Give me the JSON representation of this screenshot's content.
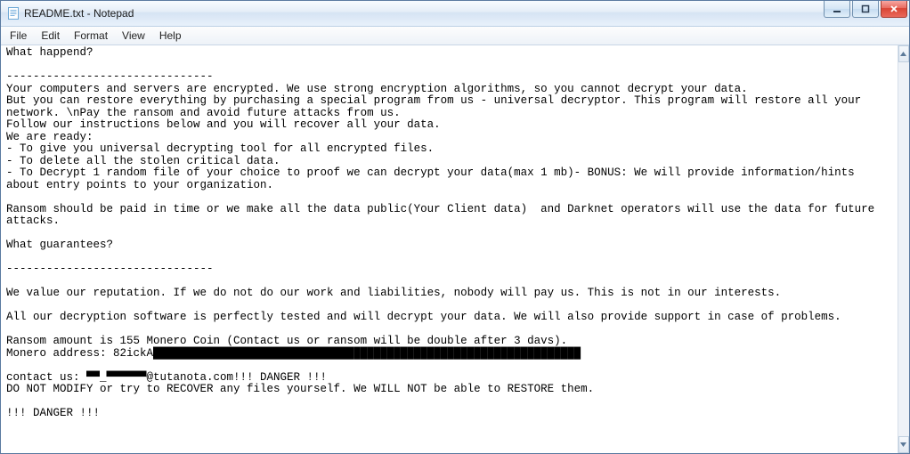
{
  "window": {
    "title": "README.txt - Notepad"
  },
  "menu": {
    "file": "File",
    "edit": "Edit",
    "format": "Format",
    "view": "View",
    "help": "Help"
  },
  "document": {
    "body": "What happend?\n\n-------------------------------\nYour computers and servers are encrypted. We use strong encryption algorithms, so you cannot decrypt your data.\nBut you can restore everything by purchasing a special program from us - universal decryptor. This program will restore all your network. \\nPay the ransom and avoid future attacks from us.\nFollow our instructions below and you will recover all your data.\nWe are ready:\n- To give you universal decrypting tool for all encrypted files.\n- To delete all the stolen critical data.\n- To Decrypt 1 random file of your choice to proof we can decrypt your data(max 1 mb)- BONUS: We will provide information/hints about entry points to your organization.\n\nRansom should be paid in time or we make all the data public(Your Client data)  and Darknet operators will use the data for future attacks.\n\nWhat guarantees?\n\n-------------------------------\n\nWe value our reputation. If we do not do our work and liabilities, nobody will pay us. This is not in our interests.\n\nAll our decryption software is perfectly tested and will decrypt your data. We will also provide support in case of problems.\n\nRansom amount is 155 Monero Coin (Contact us or ransom will be double after 3 davs).\nMonero address: 82ickA████████████████████████████████████████████████████████████████\n\ncontact us: ▀▀_▀▀▀▀▀▀@tutanota.com!!! DANGER !!!\nDO NOT MODIFY or try to RECOVER any files yourself. We WILL NOT be able to RESTORE them.\n\n!!! DANGER !!!"
  }
}
